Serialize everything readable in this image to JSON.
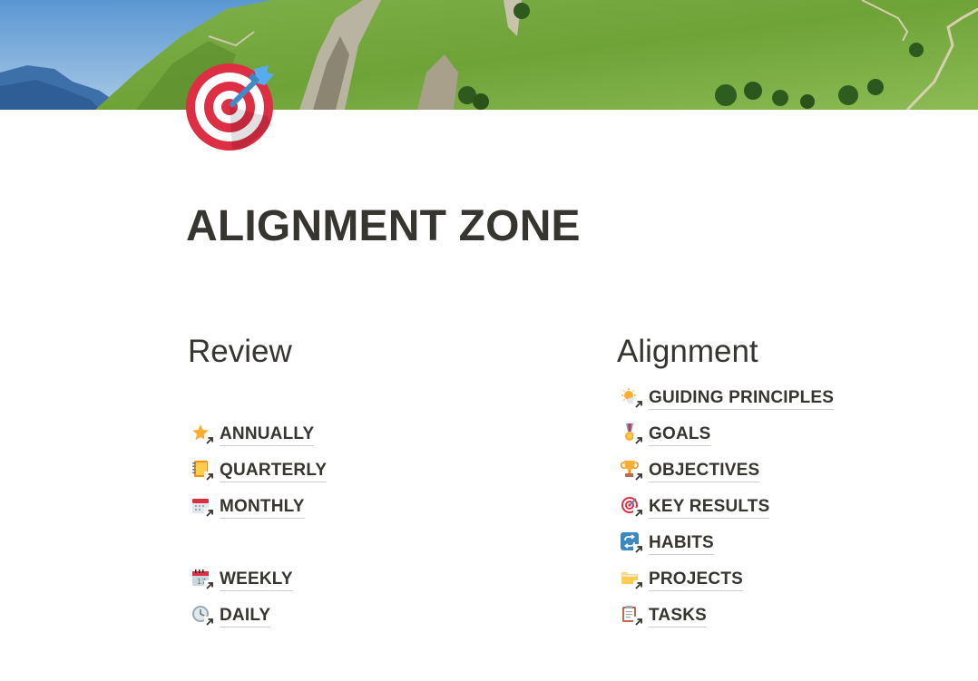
{
  "page": {
    "title": "ALIGNMENT ZONE",
    "icon": "direct-hit-target-icon"
  },
  "cover": {
    "description_icon": "mountain-landscape-cover"
  },
  "review": {
    "heading": "Review",
    "links": [
      {
        "label": "ANNUALLY",
        "icon": "star-icon"
      },
      {
        "label": "QUARTERLY",
        "icon": "notebook-icon"
      },
      {
        "label": "MONTHLY",
        "icon": "calendar-icon"
      },
      {
        "label": "WEEKLY",
        "icon": "spiral-calendar-icon"
      },
      {
        "label": "DAILY",
        "icon": "clock-icon"
      }
    ]
  },
  "alignment": {
    "heading": "Alignment",
    "links": [
      {
        "label": "GUIDING PRINCIPLES",
        "icon": "sun-behind-cloud-icon"
      },
      {
        "label": "GOALS",
        "icon": "medal-icon"
      },
      {
        "label": "OBJECTIVES",
        "icon": "trophy-icon"
      },
      {
        "label": "KEY RESULTS",
        "icon": "target-icon"
      },
      {
        "label": "HABITS",
        "icon": "repeat-icon"
      },
      {
        "label": "PROJECTS",
        "icon": "folder-icon"
      },
      {
        "label": "TASKS",
        "icon": "clipboard-icon"
      }
    ]
  },
  "colors": {
    "text": "#37352f",
    "sky": "#4a86c6",
    "grass": "#6fa33a",
    "target_red": "#dd2e44"
  }
}
